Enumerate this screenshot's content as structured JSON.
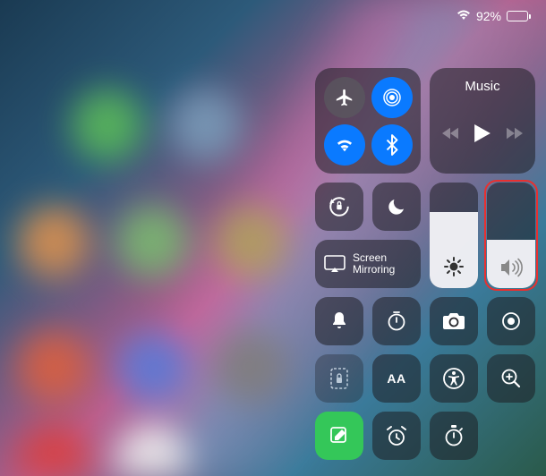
{
  "status": {
    "battery_percent": "92%",
    "wifi_strength": 3
  },
  "music": {
    "title": "Music"
  },
  "screen_mirroring": {
    "label": "Screen\nMirroring"
  },
  "sliders": {
    "brightness_percent": 72,
    "volume_percent": 46
  },
  "connectivity": {
    "airplane": false,
    "airdrop": true,
    "wifi": true,
    "bluetooth": true
  },
  "text_size_label": "AA",
  "colors": {
    "active_blue": "#0a7aff",
    "active_green": "#34c759",
    "highlight_red": "#e83030"
  }
}
